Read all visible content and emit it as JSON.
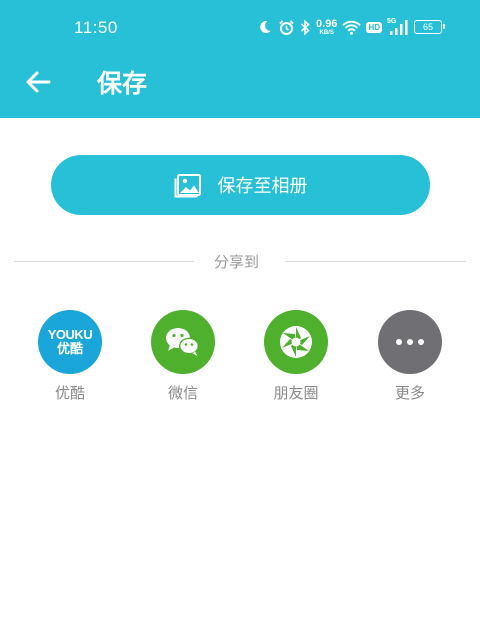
{
  "colors": {
    "accent": "#27c0d6",
    "youku": "#1aa6d9",
    "wechat": "#4eb02c",
    "moments": "#4eb02c",
    "more": "#6f6f74"
  },
  "status_bar": {
    "time": "11:50",
    "net_speed_value": "0.96",
    "net_speed_unit": "KB/S",
    "hd_label": "HD",
    "signal_label": "5G",
    "battery": "65"
  },
  "header": {
    "back_icon": "arrow-left-icon",
    "title": "保存"
  },
  "save_button": {
    "icon": "gallery-icon",
    "label": "保存至相册"
  },
  "share": {
    "label": "分享到",
    "items": [
      {
        "label": "优酷",
        "icon": "youku-icon",
        "logo_line1": "YOUKU",
        "logo_line2": "优酷"
      },
      {
        "label": "微信",
        "icon": "wechat-icon"
      },
      {
        "label": "朋友圈",
        "icon": "moments-icon"
      },
      {
        "label": "更多",
        "icon": "more-icon"
      }
    ]
  }
}
